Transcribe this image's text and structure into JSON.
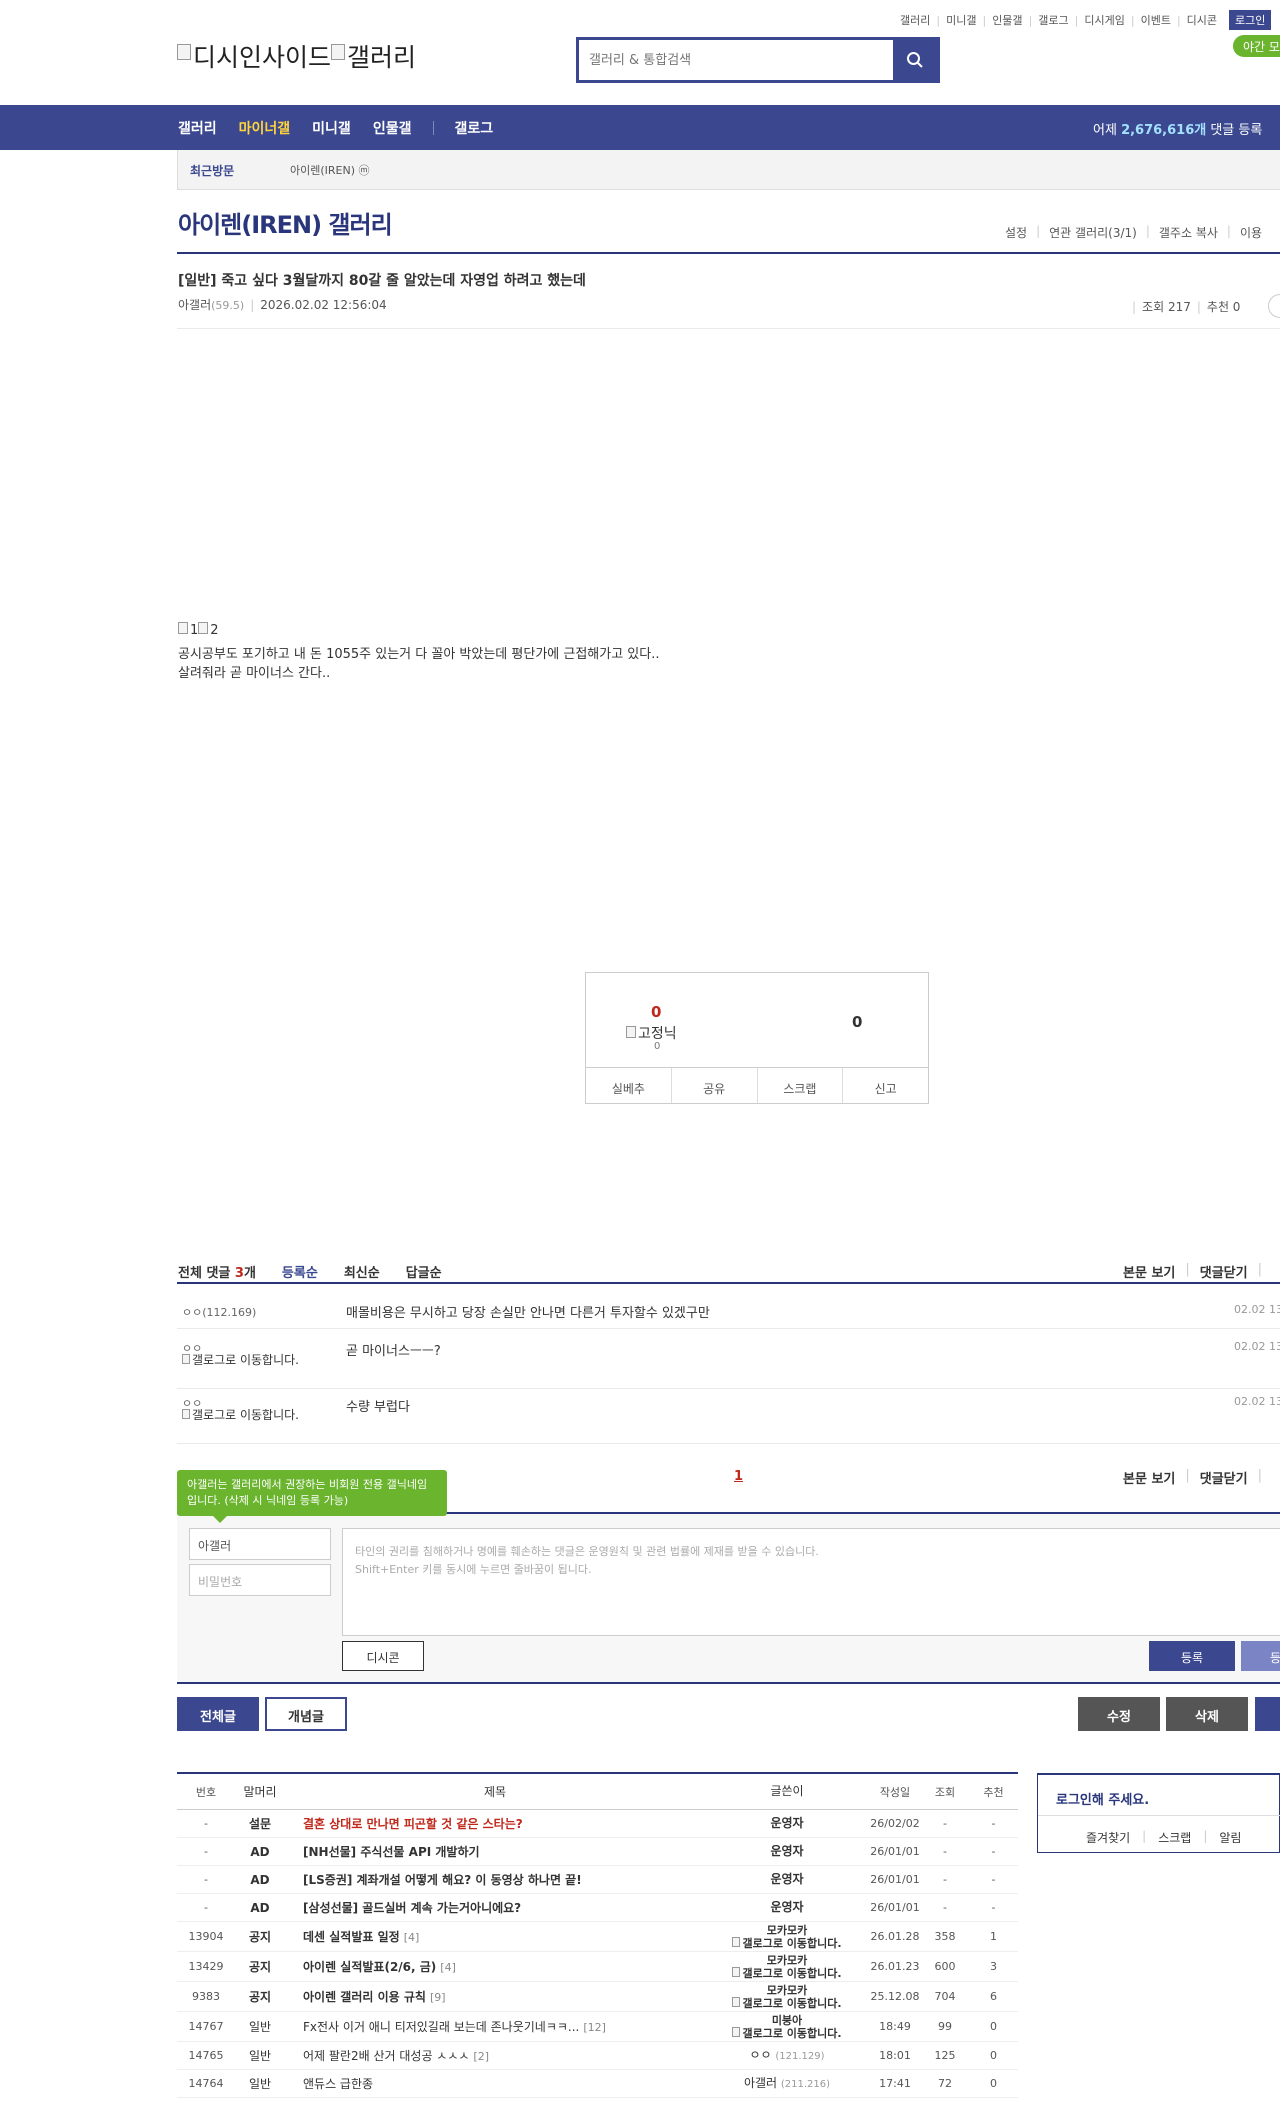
{
  "util_menu": [
    "갤러리",
    "미니갤",
    "인물갤",
    "갤로그",
    "디시게임",
    "이벤트",
    "디시콘"
  ],
  "login_label": "로그인",
  "night_label": "야간 모",
  "logo_alt": "디시인사이드",
  "logo_alt2": "갤러리",
  "search": {
    "placeholder": "갤러리 & 통합검색"
  },
  "gnb": {
    "items": [
      "갤러리",
      "마이너갤",
      "미니갤",
      "인물갤",
      "갤로그"
    ],
    "yesterday_prefix": "어제 ",
    "yesterday_count": "2,676,616개",
    "yesterday_suffix": " 댓글 등록"
  },
  "recent": {
    "label": "최근방문",
    "item": "아이렌(IREN) ⓜ"
  },
  "gallery": {
    "title": "아이렌(IREN) 갤러리",
    "menu": [
      "설정",
      "연관 갤러리(3/1)",
      "갤주소 복사",
      "이용"
    ]
  },
  "post": {
    "title": "[일반] 죽고 싶다 3월달까지 80갈 줄 알았는데 자영업 하려고 했는데",
    "author": "아갤러",
    "ip": "(59.5)",
    "date": "2026.02.02 12:56:04",
    "views": "조회 217",
    "recs": "추천 0",
    "img_alt1": "1",
    "img_alt2": "2",
    "line1": "공시공부도 포기하고 내 돈 1055주 있는거 다 꼴아 박았는데 평단가에 근접해가고 있다..",
    "line2": "살려줘라 곧 마이너스 간다.."
  },
  "recommend": {
    "up": "0",
    "fix_nick": "고정닉",
    "fix_count": "0",
    "down": "0",
    "buttons": [
      "실베추",
      "공유",
      "스크랩",
      "신고"
    ]
  },
  "comments": {
    "label_prefix": "전체 댓글 ",
    "count": "3",
    "label_suffix": "개",
    "sort": [
      "등록순",
      "최신순",
      "답글순"
    ],
    "right": [
      "본문 보기",
      "댓글닫기"
    ],
    "items": [
      {
        "nick": "ㅇㅇ(112.169)",
        "text": "매몰비용은 무시하고 당장 손실만 안나면 다른거 투자할수 있겠구만",
        "date": "02.02 13"
      },
      {
        "nick": "ㅇㅇ",
        "img": "갤로그로 이동합니다.",
        "text": "곧 마이너스ㅡㅡ?",
        "date": "02.02 13"
      },
      {
        "nick": "ㅇㅇ",
        "img": "갤로그로 이동합니다.",
        "text": "수량 부럽다",
        "date": "02.02 13"
      }
    ],
    "page": "1"
  },
  "comment_write": {
    "tooltip": "아갤러는 갤러리에서 권장하는 비회원 전용 갤닉네임입니다. (삭제 시 닉네임 등록 가능)",
    "nick_value": "아갤러",
    "pw_placeholder": "비밀번호",
    "notice1": "타인의 권리를 침해하거나 명예를 훼손하는 댓글은 운영원칙 및 관련 법률에 제재를 받을 수 있습니다.",
    "notice2": "Shift+Enter 키를 동시에 누르면 줄바꿈이 됩니다.",
    "dccon": "디시콘",
    "register": "등록",
    "register2": "등록"
  },
  "tabs": {
    "all": "전체글",
    "best": "개념글",
    "edit": "수정",
    "delete": "삭제"
  },
  "list": {
    "headers": [
      "번호",
      "말머리",
      "제목",
      "글쓴이",
      "작성일",
      "조회",
      "추천"
    ],
    "rows": [
      {
        "no": "-",
        "head": "설문",
        "title": "결혼 상대로 만나면 피곤할 것 같은 스타는?",
        "cnt": "",
        "writer": "운영자",
        "sub": "",
        "date": "26/02/02",
        "views": "-",
        "recs": "-",
        "style": "red"
      },
      {
        "no": "-",
        "head": "AD",
        "title": "[NH선물] 주식선물 API 개발하기",
        "cnt": "",
        "writer": "운영자",
        "sub": "",
        "date": "26/01/01",
        "views": "-",
        "recs": "-",
        "style": "bold"
      },
      {
        "no": "-",
        "head": "AD",
        "title": "[LS증권] 계좌개설 어떻게 해요? 이 동영상 하나면 끝!",
        "cnt": "",
        "writer": "운영자",
        "sub": "",
        "date": "26/01/01",
        "views": "-",
        "recs": "-",
        "style": "bold"
      },
      {
        "no": "-",
        "head": "AD",
        "title": "[삼성선물] 골드실버 계속 가는거아니에요?",
        "cnt": "",
        "writer": "운영자",
        "sub": "",
        "date": "26/01/01",
        "views": "-",
        "recs": "-",
        "style": "bold"
      },
      {
        "no": "13904",
        "head": "공지",
        "title": "데센 실적발표 일정",
        "cnt": "[4]",
        "writer": "모카모카",
        "sub": "갤로그로 이동합니다.",
        "date": "26.01.28",
        "views": "358",
        "recs": "1",
        "style": "bold"
      },
      {
        "no": "13429",
        "head": "공지",
        "title": "아이렌 실적발표(2/6, 금)",
        "cnt": "[4]",
        "writer": "모카모카",
        "sub": "갤로그로 이동합니다.",
        "date": "26.01.23",
        "views": "600",
        "recs": "3",
        "style": "bold"
      },
      {
        "no": "9383",
        "head": "공지",
        "title": "아이렌 갤러리 이용 규칙",
        "cnt": "[9]",
        "writer": "모카모카",
        "sub": "갤로그로 이동합니다.",
        "date": "25.12.08",
        "views": "704",
        "recs": "6",
        "style": "bold"
      },
      {
        "no": "14767",
        "head": "일반",
        "title": "Fx전사 이거 애니 티저있길래 보는데 존나웃기네ㅋㅋ...",
        "cnt": "[12]",
        "writer": "미붕아",
        "sub": "갤로그로 이동합니다.",
        "date": "18:49",
        "views": "99",
        "recs": "0",
        "style": "normal"
      },
      {
        "no": "14765",
        "head": "일반",
        "title": "어제 팔란2배 산거 대성공 ㅅㅅㅅ",
        "cnt": "[2]",
        "writer": "ㅇㅇ",
        "ip": "(121.129)",
        "sub": "",
        "date": "18:01",
        "views": "125",
        "recs": "0",
        "style": "normal"
      },
      {
        "no": "14764",
        "head": "일반",
        "title": "앤듀스 급한종",
        "cnt": "",
        "writer": "아갤러",
        "ip": "(211.216)",
        "sub": "",
        "date": "17:41",
        "views": "72",
        "recs": "0",
        "style": "normal"
      }
    ]
  },
  "login_box": {
    "title": "로그인해 주세요.",
    "menu": [
      "즐겨찾기",
      "스크랩",
      "알림"
    ]
  },
  "colors": {
    "brand": "#3b4890",
    "accent": "#ffd43b",
    "green": "#6ab42e",
    "red": "#c0281b"
  }
}
